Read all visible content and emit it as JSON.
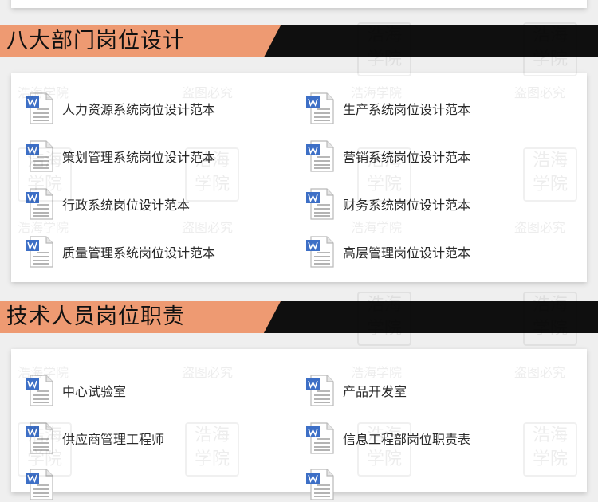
{
  "watermark": {
    "brand": "浩海学院",
    "notice": "盗图必究",
    "seal_top": "浩海",
    "seal_bottom": "学院"
  },
  "icon": "word-document-icon",
  "colors": {
    "banner_accent": "#ee9a72",
    "banner_dark": "#0f0f0f",
    "card_bg": "#ffffff",
    "page_bg": "#efefef",
    "icon_blue": "#3d6fc6"
  },
  "sections": [
    {
      "title": "八大部门岗位设计",
      "items": [
        "人力资源系统岗位设计范本",
        "生产系统岗位设计范本",
        "策划管理系统岗位设计范本",
        "营销系统岗位设计范本",
        "行政系统岗位设计范本",
        "财务系统岗位设计范本",
        "质量管理系统岗位设计范本",
        "高层管理岗位设计范本"
      ]
    },
    {
      "title": "技术人员岗位职责",
      "items": [
        "中心试验室",
        "产品开发室",
        "供应商管理工程师",
        "信息工程部岗位职责表"
      ]
    }
  ]
}
